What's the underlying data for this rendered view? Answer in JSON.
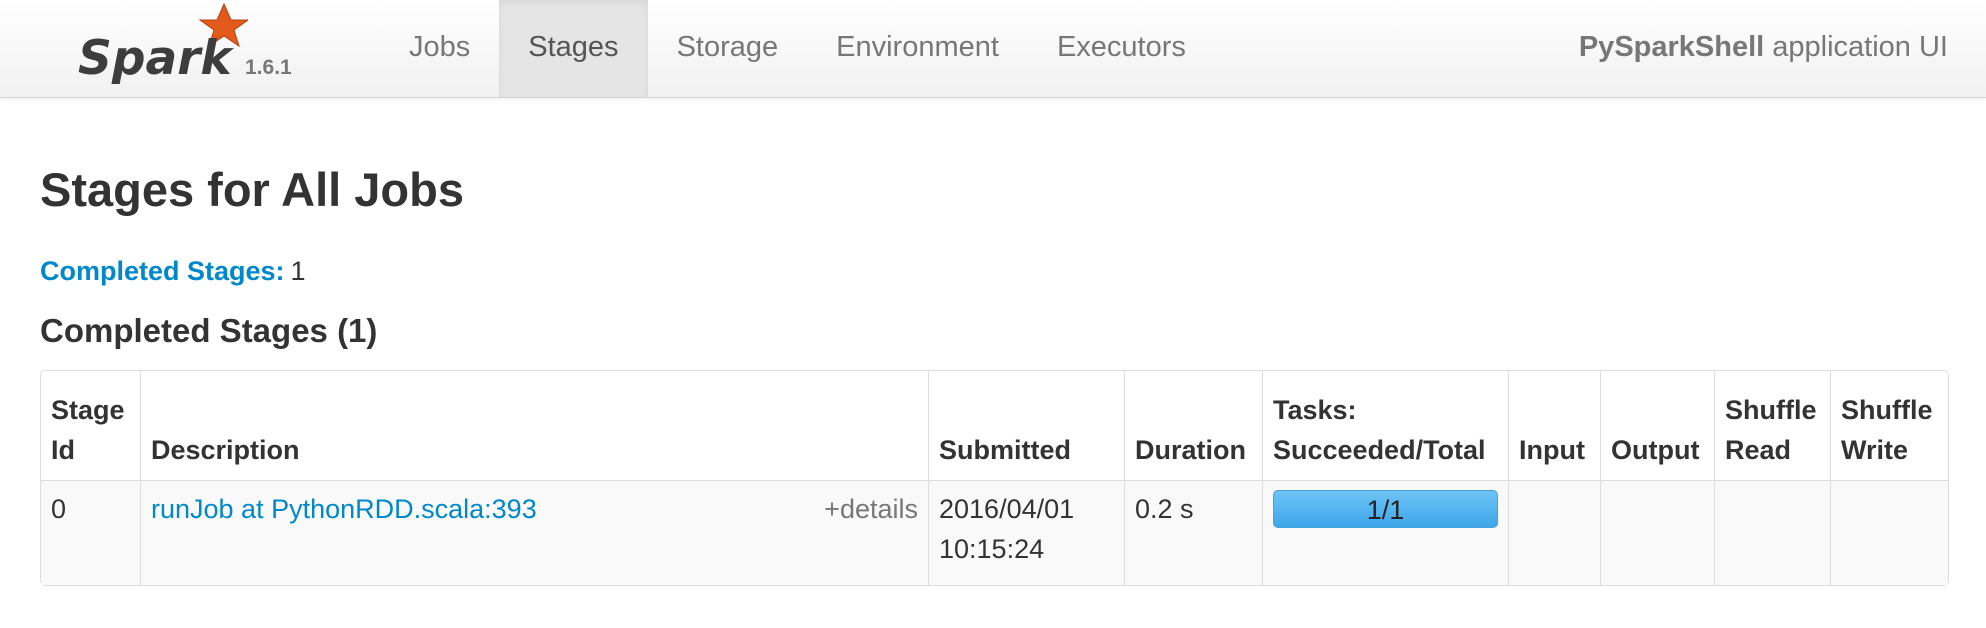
{
  "navbar": {
    "brand_name": "Spark",
    "version": "1.6.1",
    "tabs": [
      {
        "label": "Jobs",
        "active": false
      },
      {
        "label": "Stages",
        "active": true
      },
      {
        "label": "Storage",
        "active": false
      },
      {
        "label": "Environment",
        "active": false
      },
      {
        "label": "Executors",
        "active": false
      }
    ],
    "app_name_bold": "PySparkShell",
    "app_name_suffix": " application UI"
  },
  "page": {
    "title": "Stages for All Jobs",
    "summary_label": "Completed Stages:",
    "summary_value": "1",
    "section_title": "Completed Stages (1)"
  },
  "table": {
    "headers": {
      "stage_id": [
        "Stage",
        "Id"
      ],
      "description": "Description",
      "submitted": "Submitted",
      "duration": "Duration",
      "tasks": [
        "Tasks:",
        "Succeeded/Total"
      ],
      "input": "Input",
      "output": "Output",
      "shuffle_read": [
        "Shuffle",
        "Read"
      ],
      "shuffle_write": [
        "Shuffle",
        "Write"
      ]
    },
    "rows": [
      {
        "stage_id": "0",
        "description": "runJob at PythonRDD.scala:393",
        "details_label": "+details",
        "submitted_date": "2016/04/01",
        "submitted_time": "10:15:24",
        "duration": "0.2 s",
        "tasks_text": "1/1",
        "tasks_progress": 1.0,
        "input": "",
        "output": "",
        "shuffle_read": "",
        "shuffle_write": ""
      }
    ]
  },
  "colors": {
    "link": "#0088cc",
    "progress_bar": "#3ea6ea",
    "logo_star": "#e25a1c"
  },
  "icons": {
    "brand_logo": "spark-logo"
  }
}
